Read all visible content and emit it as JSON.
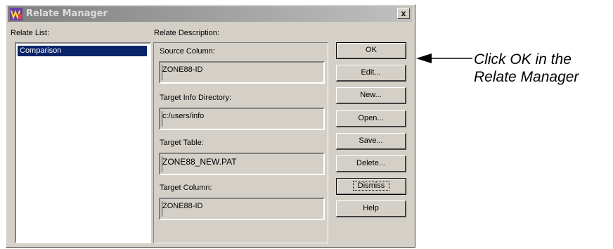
{
  "window": {
    "title": "Relate Manager",
    "close_label": "x"
  },
  "relate_list": {
    "label": "Relate List:",
    "items": [
      "Comparison"
    ]
  },
  "relate_description": {
    "label": "Relate Description:",
    "source_column": {
      "label": "Source Column:",
      "value": "ZONE88-ID"
    },
    "target_info_directory": {
      "label": "Target Info Directory:",
      "value": "c:/users/info"
    },
    "target_table": {
      "label": "Target Table:",
      "value": "ZONE88_NEW.PAT"
    },
    "target_column": {
      "label": "Target Column:",
      "value": "ZONE88-ID"
    }
  },
  "buttons": {
    "ok": "OK",
    "edit": "Edit...",
    "new": "New...",
    "open": "Open...",
    "save": "Save...",
    "delete": "Delete...",
    "dismiss": "Dismiss",
    "help": "Help"
  },
  "annotation": {
    "line1": "Click OK in the",
    "line2": "Relate Manager"
  },
  "colors": {
    "dialog_face": "#d4d0c8",
    "selection": "#0a246a",
    "titlebar_inactive": "#7f7f7f"
  }
}
